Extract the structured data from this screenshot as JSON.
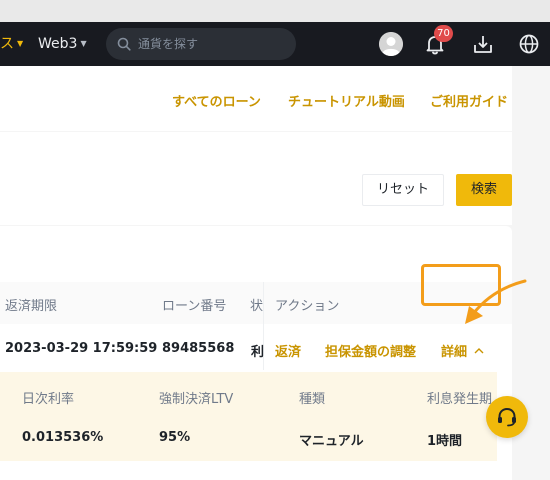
{
  "header": {
    "nav_cut_label": "ス",
    "nav_web3_label": "Web3",
    "search_placeholder": "通貨を探す",
    "notification_count": "70"
  },
  "links": {
    "all_loans": "すべてのローン",
    "tutorial_video": "チュートリアル動画",
    "user_guide": "ご利用ガイド"
  },
  "filter": {
    "reset_label": "リセット",
    "search_label": "検索"
  },
  "table": {
    "headers": [
      "返済期限",
      "ローン番号",
      "状",
      "アクション"
    ],
    "row": {
      "due_date": "2023-03-29 17:59:59",
      "loan_no": "89485568",
      "status_cut": "利",
      "actions": [
        "返済",
        "担保金額の調整",
        "詳細"
      ]
    }
  },
  "detail": {
    "headers": [
      "日次利率",
      "強制決済LTV",
      "種類",
      "利息発生期"
    ],
    "values": [
      "0.013536%",
      "95%",
      "マニュアル",
      "1時間"
    ]
  },
  "colors": {
    "brand_yellow": "#F0B90B",
    "link_gold": "#C99400",
    "highlight_orange": "#F39D1A",
    "badge_red": "#E04B4B",
    "topbar_dark": "#181A20"
  }
}
